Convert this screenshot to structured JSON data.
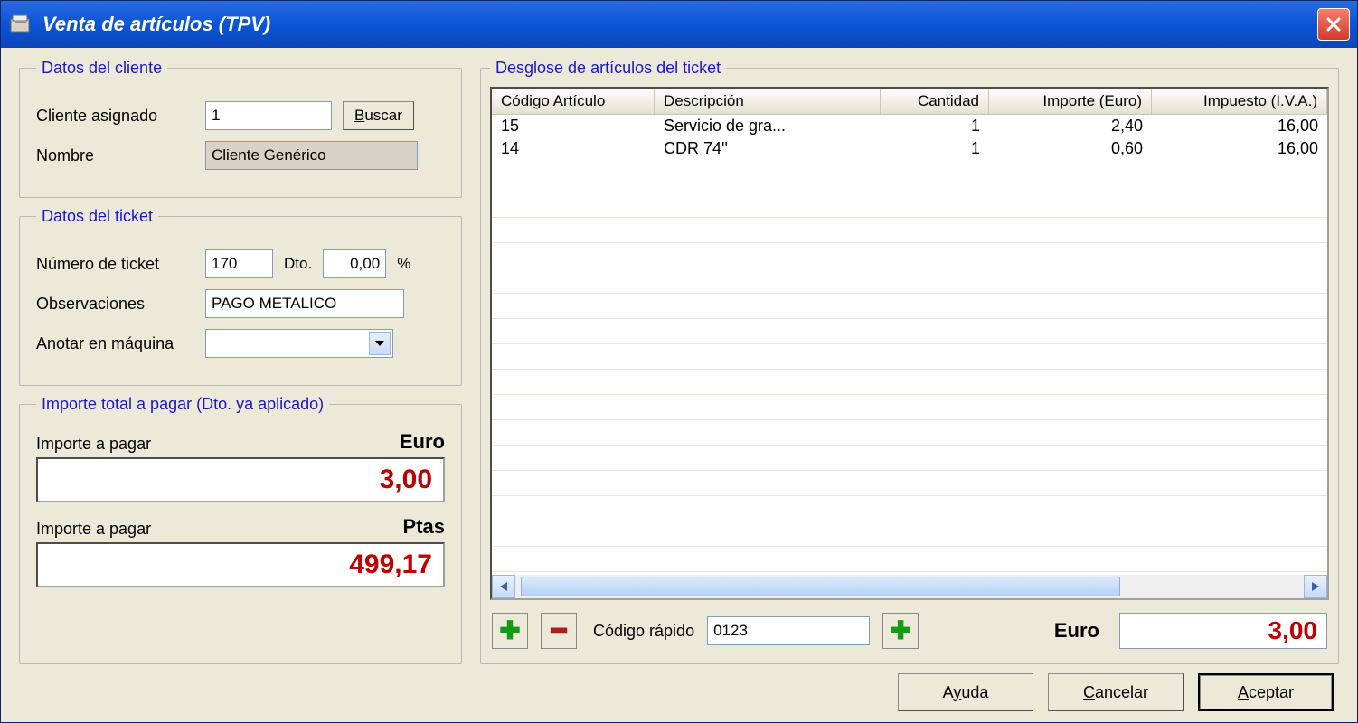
{
  "window": {
    "title": "Venta de artículos (TPV)"
  },
  "client": {
    "legend": "Datos del cliente",
    "assigned_label": "Cliente asignado",
    "assigned_value": "1",
    "search_label": "Buscar",
    "name_label": "Nombre",
    "name_value": "Cliente Genérico"
  },
  "ticket": {
    "legend": "Datos del ticket",
    "number_label": "Número de ticket",
    "number_value": "170",
    "dto_label": "Dto.",
    "dto_value": "0,00",
    "dto_unit": "%",
    "obs_label": "Observaciones",
    "obs_value": "PAGO METALICO",
    "machine_label": "Anotar en máquina",
    "machine_value": ""
  },
  "totals": {
    "legend": "Importe total a pagar (Dto. ya aplicado)",
    "pay_label": "Importe a pagar",
    "euro_unit": "Euro",
    "euro_value": "3,00",
    "ptas_unit": "Ptas",
    "ptas_value": "499,17"
  },
  "breakdown": {
    "legend": "Desglose de artículos del ticket",
    "columns": {
      "code": "Código Artículo",
      "desc": "Descripción",
      "qty": "Cantidad",
      "amount": "Importe (Euro)",
      "tax": "Impuesto (I.V.A.)"
    },
    "rows": [
      {
        "code": "15",
        "desc": "Servicio de gra...",
        "qty": "1",
        "amount": "2,40",
        "tax": "16,00"
      },
      {
        "code": "14",
        "desc": "CDR 74''",
        "qty": "1",
        "amount": "0,60",
        "tax": "16,00"
      }
    ]
  },
  "quick": {
    "label": "Código rápido",
    "value": "0123",
    "euro_label": "Euro",
    "euro_value": "3,00"
  },
  "buttons": {
    "help": "Ayuda",
    "cancel": "Cancelar",
    "accept": "Aceptar"
  }
}
